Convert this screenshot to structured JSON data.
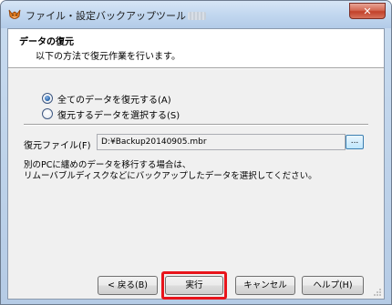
{
  "window": {
    "title": "ファイル・設定バックアップツール",
    "close_glyph": "✕"
  },
  "header": {
    "title": "データの復元",
    "subtitle": "以下の方法で復元作業を行います。"
  },
  "options": [
    {
      "label": "全てのデータを復元する(A)",
      "selected": true
    },
    {
      "label": "復元するデータを選択する(S)",
      "selected": false
    }
  ],
  "file": {
    "label": "復元ファイル(F)",
    "value": "D:¥Backup20140905.mbr",
    "browse_label": "..."
  },
  "note": {
    "line1": "別のPCに纏めのデータを移行する場合は、",
    "line2": "リムーバブルディスクなどにバックアップしたデータを選択してください。"
  },
  "buttons": {
    "back": "< 戻る(B)",
    "execute": "実行",
    "cancel": "キャンセル",
    "help": "ヘルプ(H)"
  },
  "colors": {
    "highlight": "#e8141b",
    "titlebar": "#c2d7ef"
  },
  "icons": {
    "app": "fox-app-icon",
    "close": "close-icon"
  }
}
